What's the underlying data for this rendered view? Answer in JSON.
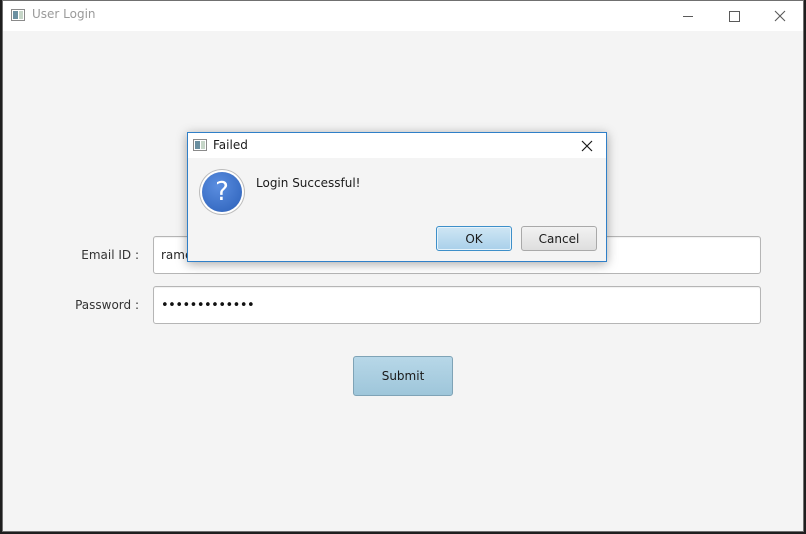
{
  "window": {
    "title": "User Login",
    "icon": "app-window-icon"
  },
  "form": {
    "email_label": "Email ID :",
    "email_value": "rame",
    "password_label": "Password :",
    "password_value": "•••••••••••••",
    "submit_label": "Submit"
  },
  "dialog": {
    "title": "Failed",
    "icon": "question-icon",
    "message": "Login Successful!",
    "ok_label": "OK",
    "cancel_label": "Cancel"
  },
  "colors": {
    "dialog_border": "#2f7fc8",
    "submit_button": "#a9d0e4",
    "question_icon": "#2a5fb8"
  }
}
